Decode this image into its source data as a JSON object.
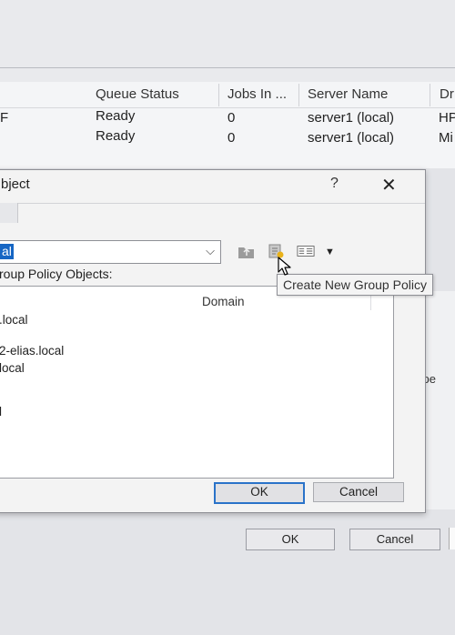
{
  "background_list": {
    "columns": [
      "Queue Status",
      "Jobs In ...",
      "Server Name",
      "Dr"
    ],
    "rows": [
      {
        "prefix": "F",
        "queue_status": "Ready",
        "jobs": "0",
        "server": "server1 (local)",
        "driver": "HP"
      },
      {
        "prefix": "",
        "queue_status": "Ready",
        "jobs": "0",
        "server": "server1 (local)",
        "driver": "Mi"
      }
    ]
  },
  "background_right_label": "ype",
  "dialog": {
    "title": "bject",
    "help": "?",
    "close": "✕",
    "combo_value": "al",
    "combo_arrow": "⌵",
    "label": "roup Policy Objects:",
    "list_header": "Domain",
    "items": [
      ".local",
      "2-elias.local",
      "local",
      "l"
    ],
    "ok": "OK",
    "cancel": "Cancel",
    "toolbar_dropdown": "▼"
  },
  "tooltip": "Create New Group Policy",
  "outer_buttons": {
    "ok": "OK",
    "cancel": "Cancel"
  }
}
